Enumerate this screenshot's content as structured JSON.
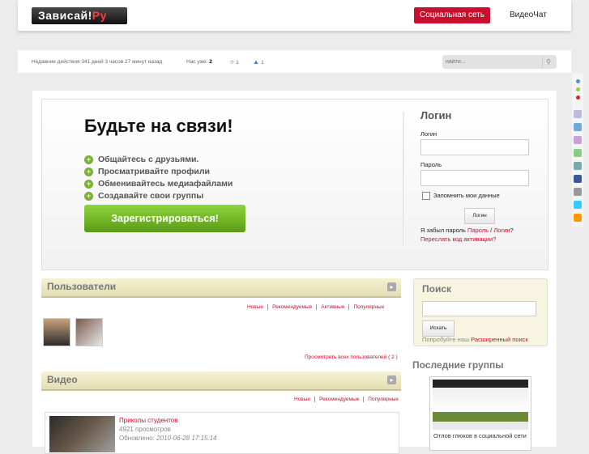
{
  "header": {
    "logo_main": "Зависай!",
    "logo_accent": "Ру",
    "social_label": "Социальная сеть",
    "videochat_label": "ВидеоЧат"
  },
  "status": {
    "last_activity": "Недавние действия 341 дней 3 часов 27 минут назад",
    "online_label": "Нас уже:",
    "online_count": "2",
    "stat1": "1",
    "stat2": "1",
    "search_placeholder": "найти..."
  },
  "hero": {
    "title": "Будьте на связи!",
    "features": [
      "Общайтесь с друзьями.",
      "Просматривайте профили",
      "Обменивайтесь медиафайлами",
      "Создавайте свои группы"
    ],
    "register_label": "Зарегистрироваться!"
  },
  "login": {
    "title": "Логин",
    "login_label": "Логин",
    "password_label": "Пароль",
    "remember_label": "Запомнить мои данные",
    "submit_label": "Логин",
    "forgot_prefix": "Я забыл пароль",
    "forgot_password": "Пароль",
    "forgot_sep": "/",
    "forgot_login": "Логин",
    "forgot_suffix": "?",
    "resend_activation": "Переслать код активации?"
  },
  "users": {
    "title": "Пользователи",
    "tabs": [
      "Новые",
      "Рекомендуемые",
      "Активные",
      "Популярные"
    ],
    "view_all": "Просмотреть всех пользователей ( 2 )"
  },
  "video": {
    "title": "Видео",
    "tabs": [
      "Новые",
      "Рекомендуемые",
      "Популярные"
    ],
    "item": {
      "title": "Приколы студентов",
      "views": "4921 просмотров",
      "updated_label": "Обновлено:",
      "updated": "2010-06-28 17:15:14"
    }
  },
  "side_search": {
    "title": "Поиск",
    "submit_label": "Искать",
    "hint_prefix": "Попробуйте наш",
    "hint_link": "Расширенный поиск"
  },
  "groups": {
    "title": "Последние группы",
    "item_name": "Отлов глюков в социальной сети"
  },
  "colors": {
    "accent": "#c8102e",
    "green": "#6aad1f",
    "panel": "#e9e5c2"
  }
}
